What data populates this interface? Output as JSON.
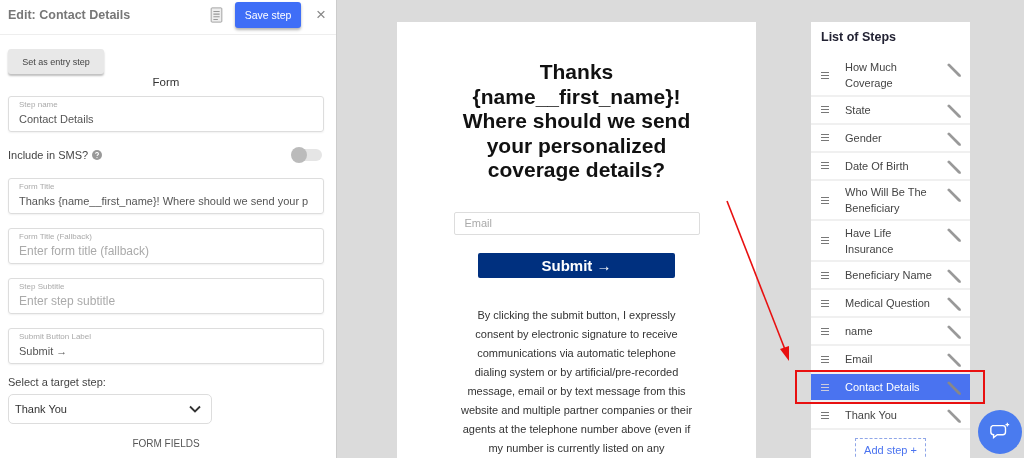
{
  "editor": {
    "title": "Edit: Contact Details",
    "save_button": "Save step",
    "close_button": "×",
    "entry_button": "Set as entry step",
    "section_title": "Form",
    "fields": [
      {
        "kind": "text",
        "label": "Step name",
        "value": "Contact Details"
      },
      {
        "kind": "toggle",
        "label": "Include in SMS?",
        "on": false
      },
      {
        "kind": "text",
        "label": "Form Title",
        "value": "Thanks {name__first_name}! Where should we send your p"
      },
      {
        "kind": "text",
        "label": "Form Title (Fallback)",
        "placeholder": "Enter form title (fallback)"
      },
      {
        "kind": "text",
        "label": "Step Subtitle",
        "placeholder": "Enter step subtitle"
      },
      {
        "kind": "text",
        "label": "Submit Button Label",
        "value": "Submit →"
      },
      {
        "kind": "select",
        "label": "Select a target step:",
        "value": "Thank You"
      }
    ],
    "footer_heading": "FORM FIELDS"
  },
  "preview": {
    "title_lines": [
      "Thanks",
      "{name__first_name}!",
      "Where should we send",
      "your personalized",
      "coverage details?"
    ],
    "email": {
      "placeholder": "Email"
    },
    "submit_button": "Submit →",
    "consent": "By clicking the submit button, I expressly consent by electronic signature to receive communications via automatic telephone dialing system or by artificial/pre-recorded message, email or by text message from this website and multiple partner companies or their agents at the telephone number above (even if my number is currently listed on any"
  },
  "steps": {
    "title": "List of Steps",
    "items": [
      {
        "label": "How Much Coverage",
        "selected": false
      },
      {
        "label": "State",
        "selected": false
      },
      {
        "label": "Gender",
        "selected": false
      },
      {
        "label": "Date Of Birth",
        "selected": false
      },
      {
        "label": "Who Will Be The Beneficiary",
        "selected": false
      },
      {
        "label": "Have Life Insurance",
        "selected": false
      },
      {
        "label": "Beneficiary Name",
        "selected": false
      },
      {
        "label": "Medical Question",
        "selected": false
      },
      {
        "label": "name",
        "selected": false
      },
      {
        "label": "Email",
        "selected": false
      },
      {
        "label": "Contact Details",
        "selected": true
      },
      {
        "label": "Thank You",
        "selected": false
      }
    ],
    "add_button": "Add step +"
  }
}
